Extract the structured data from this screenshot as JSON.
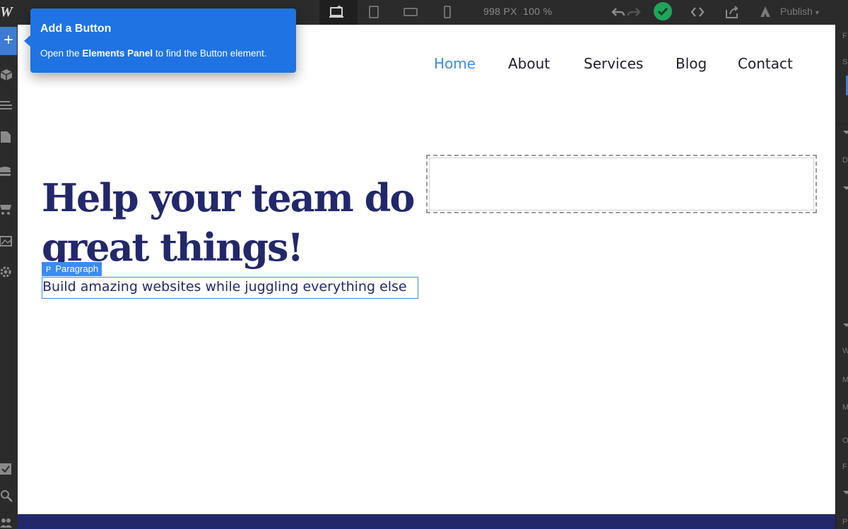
{
  "toolbar": {
    "logo": "W",
    "width_label": "998 PX",
    "zoom_label": "100 %",
    "publish_label": "Publish",
    "status_color": "#1fa55a",
    "icons": [
      "desktop-breakpoint-icon",
      "tablet-icon",
      "mobile-landscape-icon",
      "mobile-portrait-icon",
      "undo-icon",
      "redo-icon",
      "check-icon",
      "code-icon",
      "export-icon",
      "publish-icon"
    ]
  },
  "sidebar": {
    "add_label": "+",
    "icons": [
      "add-icon",
      "box-icon",
      "navigator-icon",
      "pages-icon",
      "cms-icon",
      "ecommerce-icon",
      "assets-icon",
      "settings-icon",
      "checklist-icon",
      "search-icon",
      "users-icon"
    ]
  },
  "right_panel": {
    "letters": [
      "F",
      "S",
      "D",
      "W",
      "M",
      "M",
      "O",
      "F",
      "P"
    ]
  },
  "site": {
    "nav": [
      "Home",
      "About",
      "Services",
      "Blog",
      "Contact"
    ],
    "active_nav": "Home",
    "accent_color": "#3b8cf0",
    "brand_color": "#23286b",
    "hero_title": "Help your team do great things!",
    "paragraph_tag": "Paragraph",
    "paragraph_tag_icon": "P",
    "paragraph": "Build amazing websites while juggling everything else"
  },
  "tooltip": {
    "title": "Add a Button",
    "body_prefix": "Open the",
    "body_emphasis": "Elements Panel",
    "body_suffix": "to find the Button element."
  }
}
